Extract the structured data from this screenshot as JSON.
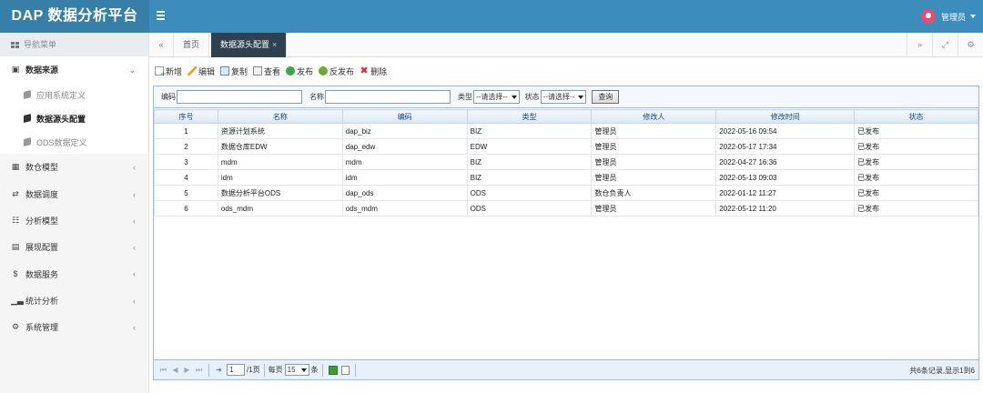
{
  "header": {
    "brand": "DAP 数据分析平台",
    "menu_icon": "hamburger-icon",
    "user_name": "管理员"
  },
  "sidebar": {
    "nav_title": "导航菜单",
    "groups": [
      {
        "label": "数据来源",
        "icon": "database-icon",
        "expanded": true,
        "children": [
          {
            "label": "应用系统定义",
            "current": false
          },
          {
            "label": "数据源头配置",
            "current": true
          },
          {
            "label": "ODS数据定义",
            "current": false
          }
        ]
      },
      {
        "label": "数仓模型",
        "icon": "cubes-icon"
      },
      {
        "label": "数据调度",
        "icon": "shuffle-icon"
      },
      {
        "label": "分析模型",
        "icon": "sitemap-icon"
      },
      {
        "label": "展现配置",
        "icon": "layout-icon"
      },
      {
        "label": "数据服务",
        "icon": "dollar-icon"
      },
      {
        "label": "统计分析",
        "icon": "bar-chart-icon"
      },
      {
        "label": "系统管理",
        "icon": "gear-icon"
      }
    ]
  },
  "tabs": [
    {
      "label": "首页",
      "active": false
    },
    {
      "label": "数据源头配置",
      "active": true,
      "close": "×"
    }
  ],
  "toolbar": {
    "new": "新增",
    "edit": "编辑",
    "copy": "复制",
    "view": "查看",
    "publish": "发布",
    "unpublish": "反发布",
    "delete": "删除"
  },
  "search": {
    "code_label": "编码",
    "name_label": "名称",
    "type_label": "类型",
    "status_label": "状态",
    "type_value": "--请选择--",
    "status_value": "--请选择--",
    "query_button": "查询"
  },
  "table": {
    "columns": [
      "序号",
      "名称",
      "编码",
      "类型",
      "修改人",
      "修改时间",
      "状态"
    ],
    "rows": [
      [
        "1",
        "资源计划系统",
        "dap_biz",
        "BIZ",
        "管理员",
        "2022-05-16 09:54",
        "已发布"
      ],
      [
        "2",
        "数据仓库EDW",
        "dap_edw",
        "EDW",
        "管理员",
        "2022-05-17 17:34",
        "已发布"
      ],
      [
        "3",
        "mdm",
        "mdm",
        "BIZ",
        "管理员",
        "2022-04-27 16:36",
        "已发布"
      ],
      [
        "4",
        "idm",
        "idm",
        "BIZ",
        "管理员",
        "2022-05-13 09:03",
        "已发布"
      ],
      [
        "5",
        "数据分析平台ODS",
        "dap_ods",
        "ODS",
        "数仓负责人",
        "2022-01-12 11:27",
        "已发布"
      ],
      [
        "6",
        "ods_mdm",
        "ods_mdm",
        "ODS",
        "管理员",
        "2022-05-12 11:20",
        "已发布"
      ]
    ]
  },
  "pager": {
    "page_value": "1",
    "page_total": "/1页",
    "per_page_label": "每页",
    "per_page_value": "15",
    "per_page_suffix": "条",
    "summary": "共6条记录,显示1到6"
  }
}
